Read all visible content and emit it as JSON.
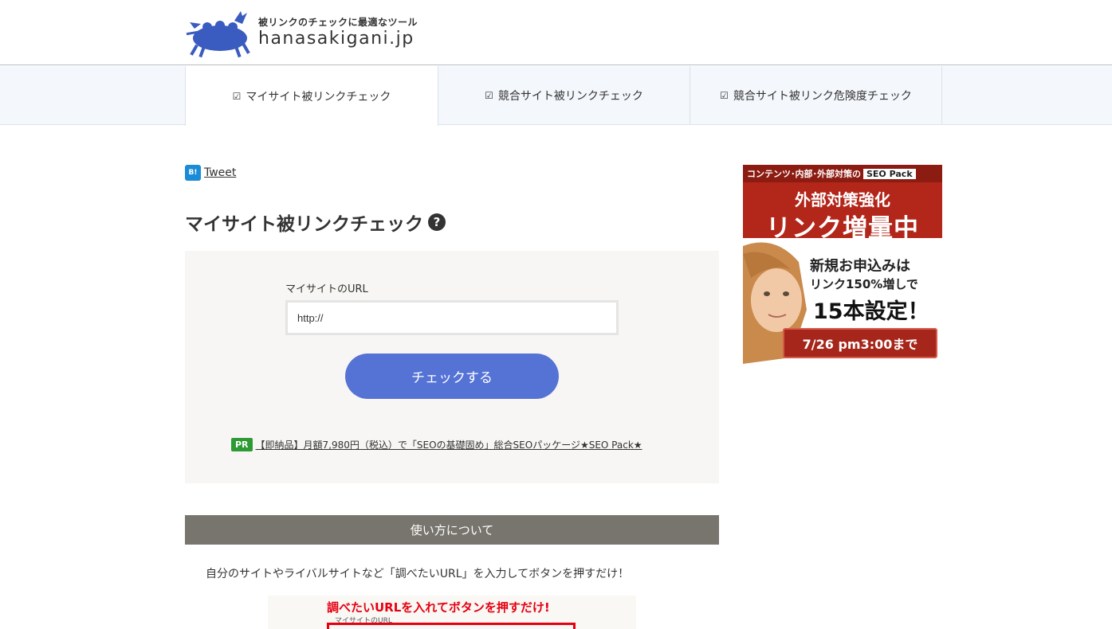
{
  "header": {
    "tagline": "被リンクのチェックに最適なツール",
    "site_name": "hanasakigani.jp"
  },
  "nav": {
    "items": [
      {
        "label": "マイサイト被リンクチェック",
        "icon": "checkbox-icon",
        "active": true
      },
      {
        "label": "競合サイト被リンクチェック",
        "icon": "checkbox-icon",
        "active": false
      },
      {
        "label": "競合サイト被リンク危険度チェック",
        "icon": "checkbox-icon",
        "active": false
      }
    ]
  },
  "social": {
    "hatena_label": "B!",
    "tweet_label": "Tweet"
  },
  "main": {
    "title": "マイサイト被リンクチェック",
    "help_glyph": "?",
    "form": {
      "url_label": "マイサイトのURL",
      "url_value": "http://",
      "submit_label": "チェックする"
    },
    "pr": {
      "badge": "PR",
      "link_text": "【即納品】月額7,980円（税込）で「SEOの基礎固め」総合SEOパッケージ★SEO Pack★"
    },
    "howto": {
      "heading": "使い方について",
      "description": "自分のサイトやライバルサイトなど「調べたいURL」を入力してボタンを押すだけ！",
      "image_heading": "調べたいURLを入れてボタンを押すだけ!",
      "image_sub": "マイサイトのURL"
    }
  },
  "ad": {
    "top_text": "コンテンツ･内部･外部対策の",
    "top_badge": "SEO Pack",
    "line1": "外部対策強化",
    "line2": "リンク増量中",
    "text1": "新規お申込みは",
    "text2": "リンク150%増しで",
    "text3": "15本設定！",
    "date": "7/26 pm3:00まで"
  },
  "colors": {
    "accent_button": "#5572d5",
    "section_bar": "#77756d",
    "pr_badge": "#2d9a34",
    "ad_red": "#b3261a"
  }
}
